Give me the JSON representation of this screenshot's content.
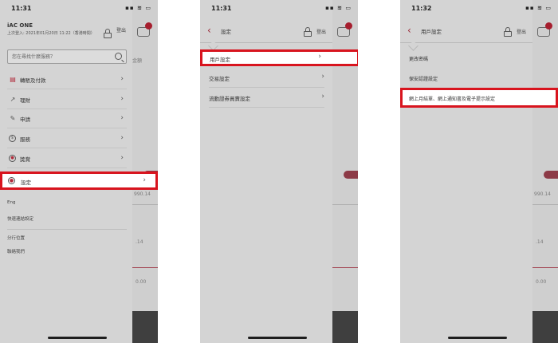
{
  "phone1": {
    "status": {
      "time": "11:31",
      "icons": "▪▪ ≋ ▭"
    },
    "brand": "iAC ONE",
    "last_login": "上次登入: 2021年01月20日 11:22（香港時間）",
    "logout_label": "登出",
    "search": {
      "placeholder": "您在尋找什麼服務？"
    },
    "menu": [
      {
        "icon": "▤",
        "label": "轉賬及付款"
      },
      {
        "icon": "↗",
        "label": "理財"
      },
      {
        "icon": "✎",
        "label": "申請"
      },
      {
        "icon": "$",
        "label": "服務"
      },
      {
        "icon": "●",
        "label": "獎賞"
      },
      {
        "icon": "●",
        "label": "設定"
      }
    ],
    "links": [
      "Eng",
      "快速連結設定",
      "分行位置",
      "聯絡我們"
    ]
  },
  "phone2": {
    "status": {
      "time": "11:31",
      "icons": "▪▪ ≋ ▭"
    },
    "title": "設定",
    "logout_label": "登出",
    "rows": [
      "用戶設定",
      "交易設定",
      "流動證券買賣設定"
    ]
  },
  "phone3": {
    "status": {
      "time": "11:32",
      "icons": "▪▪ ≋ ▭"
    },
    "title": "用戶設定",
    "logout_label": "登出",
    "rows": [
      "更改密碼",
      "保安認證設定",
      "網上月結單、網上通知書及電子提示設定"
    ]
  },
  "background_app": {
    "texts": [
      "金額",
      "990.14",
      ".14",
      "0.00"
    ]
  },
  "colors": {
    "highlight": "#d8141e",
    "accent": "#9b2a38"
  }
}
